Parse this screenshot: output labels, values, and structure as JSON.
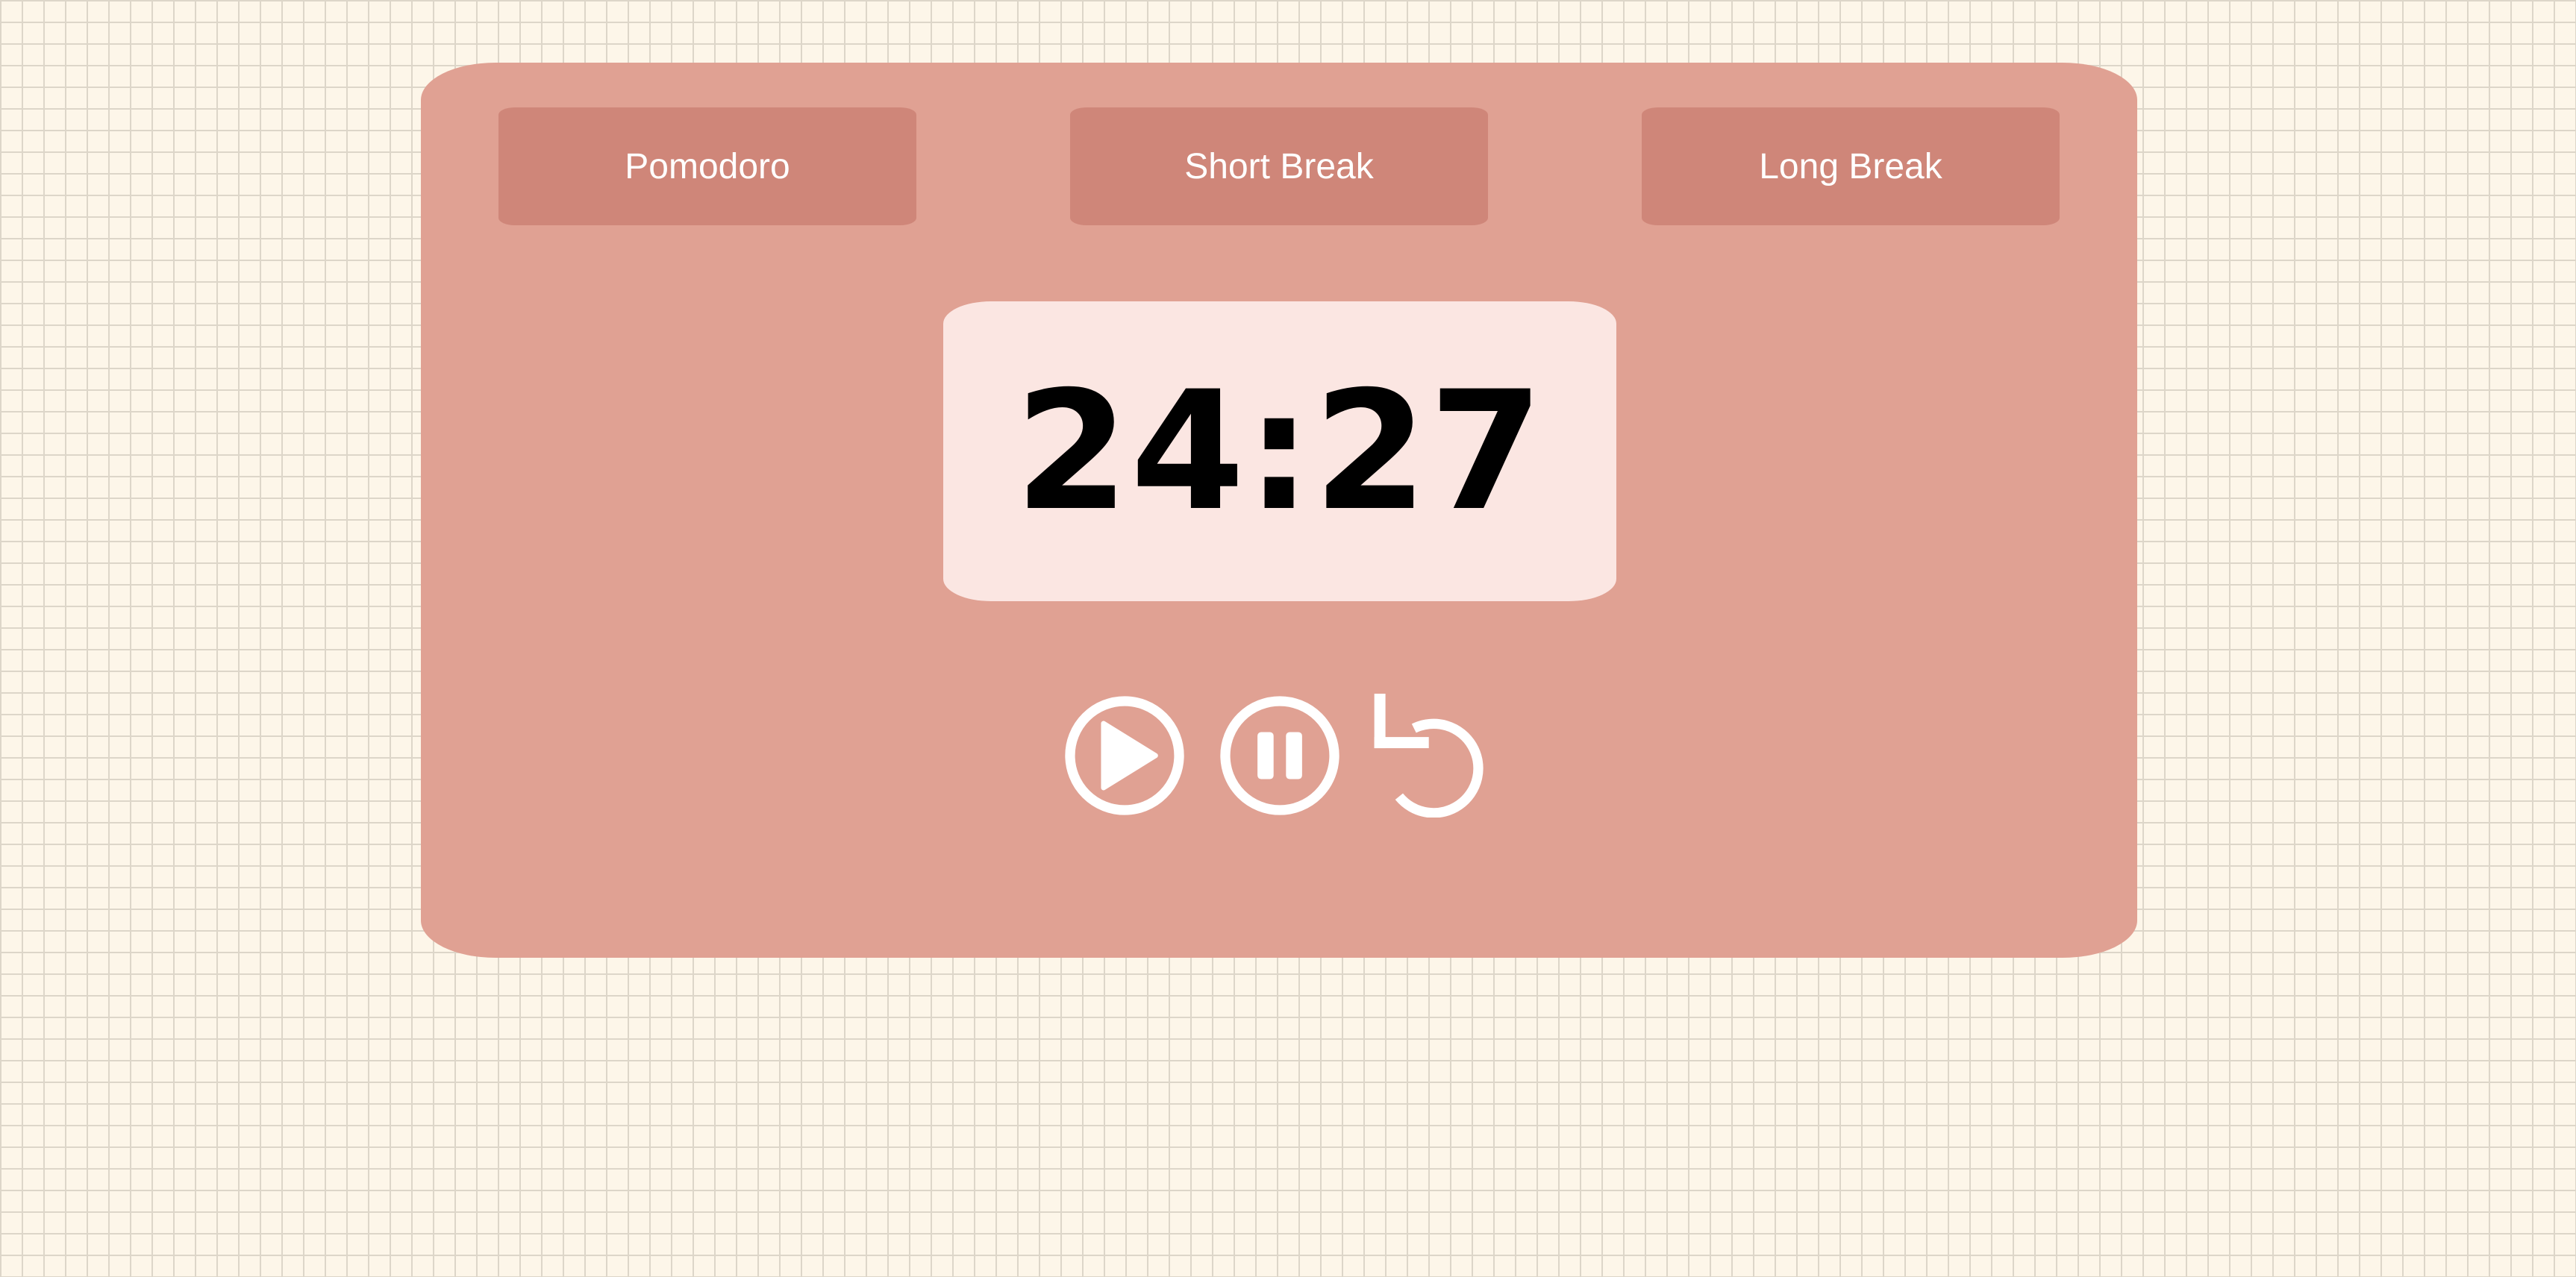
{
  "tabs": [
    {
      "label": "Pomodoro"
    },
    {
      "label": "Short Break"
    },
    {
      "label": "Long Break"
    }
  ],
  "timer": {
    "display": "24:27"
  },
  "controls": {
    "play_icon": "play-circle-icon",
    "pause_icon": "pause-circle-icon",
    "reset_icon": "reset-rotate-icon"
  },
  "colors": {
    "page_background": "#fdf6e9",
    "grid_lines": "#ddd6c9",
    "card": "#e0a193",
    "tab": "#cf8679",
    "timer_box": "#fbe6e2",
    "timer_text": "#000000",
    "icons": "#ffffff"
  }
}
